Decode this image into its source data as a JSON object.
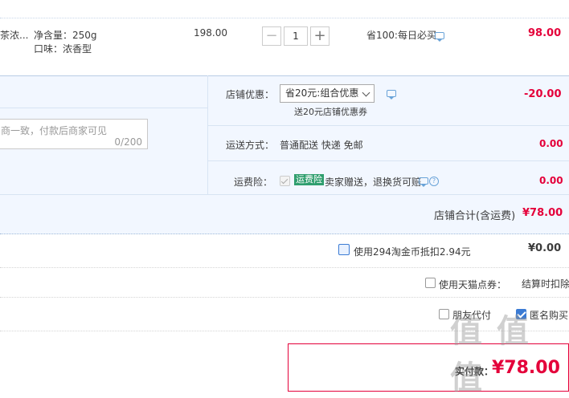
{
  "item": {
    "name": "茶浓...",
    "spec_weight": "净含量：250g",
    "spec_flavor": "口味：浓香型",
    "unit_price": "198.00",
    "quantity_minus": "−",
    "quantity": "1",
    "quantity_plus": "+",
    "promo": "省100:每日必买",
    "subtotal": "98.00"
  },
  "message": {
    "placeholder": "商一致，付款后商家可见",
    "counter": "0/200"
  },
  "shop_discount": {
    "label": "店铺优惠：",
    "selected": "省20元:组合优惠",
    "note": "送20元店铺优惠券",
    "amount": "-20.00"
  },
  "shipping": {
    "label": "运送方式：",
    "value": "普通配送 快递 免邮",
    "amount": "0.00"
  },
  "insurance": {
    "label": "运费险：",
    "badge": "运费险",
    "desc": "卖家赠送，退换货可赔",
    "amount": "0.00"
  },
  "shop_total": {
    "label": "店铺合计(含运费)",
    "amount": "¥78.00"
  },
  "taojinbi": {
    "label": "使用294淘金币抵扣2.94元",
    "amount": "¥0.00"
  },
  "tmall_points": {
    "label": "使用天猫点券：",
    "value": "结算时扣除"
  },
  "options": {
    "friend_pay": "朋友代付",
    "anonymous": "匿名购买"
  },
  "payment": {
    "label": "实付款：",
    "amount": "¥78.00"
  },
  "watermark": "值 值 值",
  "colors": {
    "accent_red": "#e4003a",
    "panel_blue": "#f2f7ff",
    "badge_green": "#2f9e6e"
  }
}
